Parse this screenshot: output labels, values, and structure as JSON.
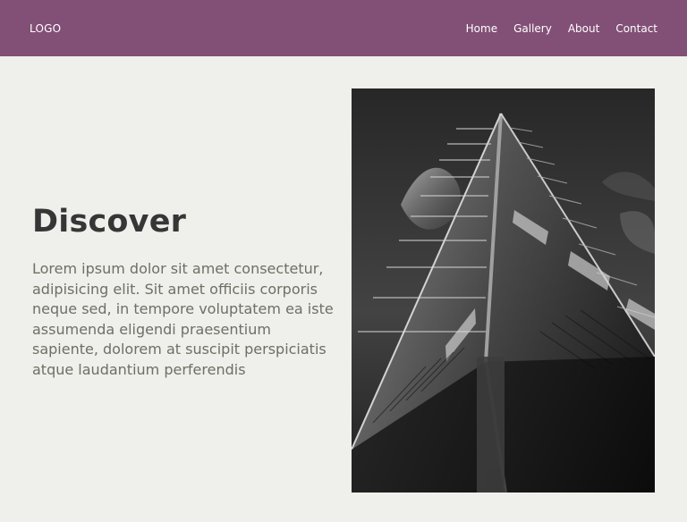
{
  "header": {
    "logo": "LOGO",
    "nav": [
      "Home",
      "Gallery",
      "About",
      "Contact"
    ]
  },
  "hero": {
    "title": "Discover",
    "body": "Lorem ipsum dolor sit amet consectetur, adipisicing elit. Sit amet officiis corporis neque sed, in tempore voluptatem ea iste assumenda eligendi praesentium sapiente, dolorem at suscipit perspiciatis atque laudantium perferendis"
  },
  "colors": {
    "header_bg": "#824f77",
    "page_bg": "#efefeb",
    "title": "#363636",
    "body": "#6f6f66"
  }
}
